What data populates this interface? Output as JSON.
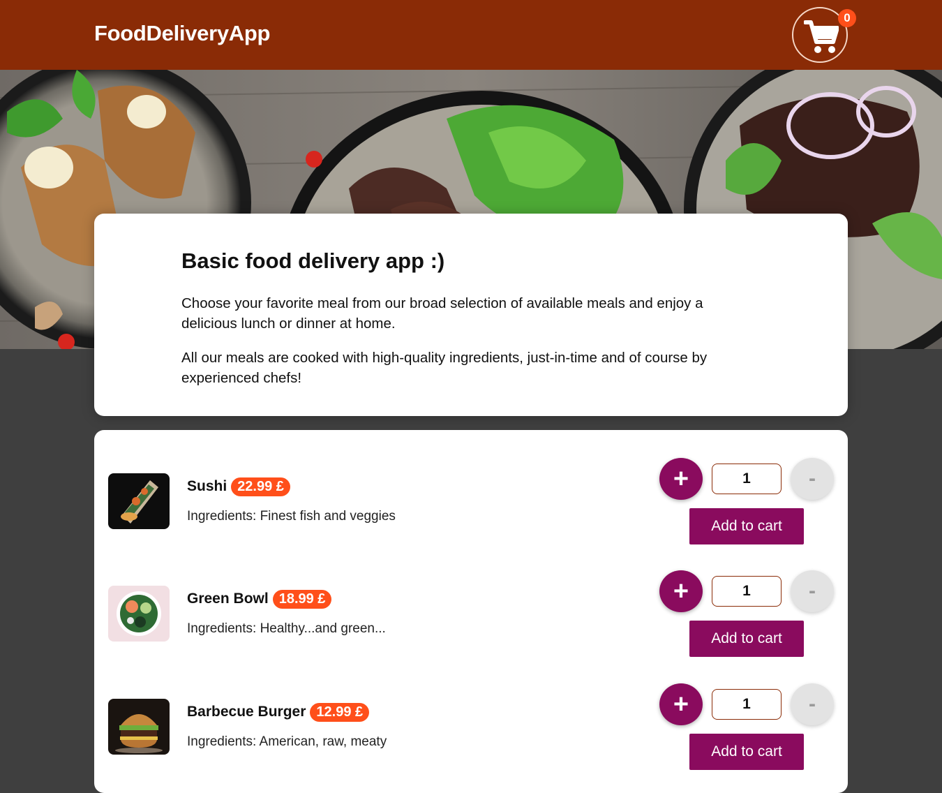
{
  "header": {
    "brand": "FoodDeliveryApp",
    "cart_count": "0"
  },
  "hero": {
    "image": "food-plates-photo"
  },
  "summary": {
    "title": "Basic food delivery app :)",
    "paragraph1": "Choose your favorite meal from our broad selection of available meals and enjoy a delicious lunch or dinner at home.",
    "paragraph2": "All our meals are cooked with high-quality ingredients, just-in-time and of course by experienced chefs!"
  },
  "meals": [
    {
      "name": "Sushi",
      "price": "22.99 £",
      "description": "Ingredients: Finest fish and veggies",
      "quantity": "1",
      "plus_label": "+",
      "minus_label": "-",
      "add_label": "Add to cart"
    },
    {
      "name": "Green Bowl",
      "price": "18.99 £",
      "description": "Ingredients: Healthy...and green...",
      "quantity": "1",
      "plus_label": "+",
      "minus_label": "-",
      "add_label": "Add to cart"
    },
    {
      "name": "Barbecue Burger",
      "price": "12.99 £",
      "description": "Ingredients: American, raw, meaty",
      "quantity": "1",
      "plus_label": "+",
      "minus_label": "-",
      "add_label": "Add to cart"
    }
  ],
  "colors": {
    "header": "#8a2b06",
    "accent": "#8a0b5e",
    "price_badge": "#ff4f1a",
    "background": "#3f3f3f"
  }
}
